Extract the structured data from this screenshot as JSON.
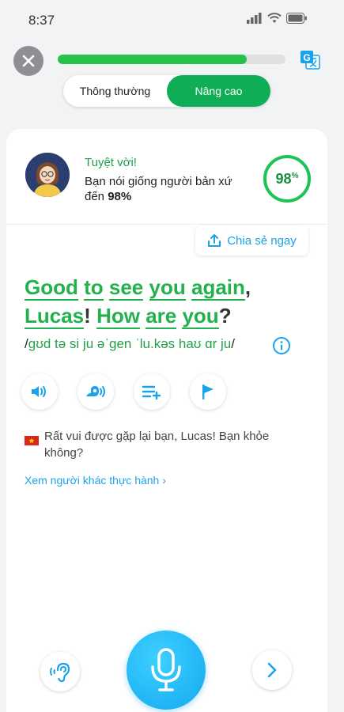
{
  "status_bar": {
    "time": "8:37"
  },
  "top_bar": {
    "progress_percent": 83,
    "progress_color": "#27c24c"
  },
  "mode_toggle": {
    "normal_label": "Thông thường",
    "advanced_label": "Nâng cao",
    "active": "advanced"
  },
  "result": {
    "praise": "Tuyệt vời!",
    "message": "Bạn nói giống người bản xứ đến ",
    "score_inline": "98%",
    "score": "98",
    "score_unit": "%"
  },
  "share": {
    "label": "Chia sẻ ngay"
  },
  "sentence": {
    "words": [
      "Good",
      "to",
      "see",
      "you",
      "again",
      "Lucas",
      "How",
      "are",
      "you"
    ],
    "punctuation": [
      ",",
      "!",
      "?"
    ]
  },
  "ipa": {
    "open": "/",
    "text": "gʊd tə si ju əˈɡen ˈlu.kəs haʊ ɑr ju",
    "close": "/"
  },
  "actions": [
    "speaker-icon",
    "slow-speaker-icon",
    "add-list-icon",
    "flag-icon"
  ],
  "translation": {
    "text": "Rất vui được gặp lại bạn, Lucas! Bạn khỏe không?"
  },
  "see_others": {
    "label": "Xem người khác thực hành",
    "chevron": "›"
  },
  "colors": {
    "accent_green": "#0fad55",
    "accent_blue": "#1aa3e8",
    "mic_blue": "#12a8f0"
  }
}
